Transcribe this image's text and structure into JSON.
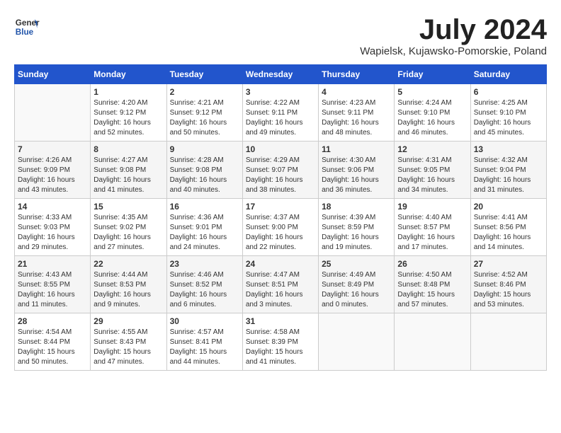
{
  "header": {
    "logo_line1": "General",
    "logo_line2": "Blue",
    "month_year": "July 2024",
    "location": "Wapielsk, Kujawsko-Pomorskie, Poland"
  },
  "days_of_week": [
    "Sunday",
    "Monday",
    "Tuesday",
    "Wednesday",
    "Thursday",
    "Friday",
    "Saturday"
  ],
  "weeks": [
    [
      {
        "num": "",
        "info": ""
      },
      {
        "num": "1",
        "info": "Sunrise: 4:20 AM\nSunset: 9:12 PM\nDaylight: 16 hours\nand 52 minutes."
      },
      {
        "num": "2",
        "info": "Sunrise: 4:21 AM\nSunset: 9:12 PM\nDaylight: 16 hours\nand 50 minutes."
      },
      {
        "num": "3",
        "info": "Sunrise: 4:22 AM\nSunset: 9:11 PM\nDaylight: 16 hours\nand 49 minutes."
      },
      {
        "num": "4",
        "info": "Sunrise: 4:23 AM\nSunset: 9:11 PM\nDaylight: 16 hours\nand 48 minutes."
      },
      {
        "num": "5",
        "info": "Sunrise: 4:24 AM\nSunset: 9:10 PM\nDaylight: 16 hours\nand 46 minutes."
      },
      {
        "num": "6",
        "info": "Sunrise: 4:25 AM\nSunset: 9:10 PM\nDaylight: 16 hours\nand 45 minutes."
      }
    ],
    [
      {
        "num": "7",
        "info": "Sunrise: 4:26 AM\nSunset: 9:09 PM\nDaylight: 16 hours\nand 43 minutes."
      },
      {
        "num": "8",
        "info": "Sunrise: 4:27 AM\nSunset: 9:08 PM\nDaylight: 16 hours\nand 41 minutes."
      },
      {
        "num": "9",
        "info": "Sunrise: 4:28 AM\nSunset: 9:08 PM\nDaylight: 16 hours\nand 40 minutes."
      },
      {
        "num": "10",
        "info": "Sunrise: 4:29 AM\nSunset: 9:07 PM\nDaylight: 16 hours\nand 38 minutes."
      },
      {
        "num": "11",
        "info": "Sunrise: 4:30 AM\nSunset: 9:06 PM\nDaylight: 16 hours\nand 36 minutes."
      },
      {
        "num": "12",
        "info": "Sunrise: 4:31 AM\nSunset: 9:05 PM\nDaylight: 16 hours\nand 34 minutes."
      },
      {
        "num": "13",
        "info": "Sunrise: 4:32 AM\nSunset: 9:04 PM\nDaylight: 16 hours\nand 31 minutes."
      }
    ],
    [
      {
        "num": "14",
        "info": "Sunrise: 4:33 AM\nSunset: 9:03 PM\nDaylight: 16 hours\nand 29 minutes."
      },
      {
        "num": "15",
        "info": "Sunrise: 4:35 AM\nSunset: 9:02 PM\nDaylight: 16 hours\nand 27 minutes."
      },
      {
        "num": "16",
        "info": "Sunrise: 4:36 AM\nSunset: 9:01 PM\nDaylight: 16 hours\nand 24 minutes."
      },
      {
        "num": "17",
        "info": "Sunrise: 4:37 AM\nSunset: 9:00 PM\nDaylight: 16 hours\nand 22 minutes."
      },
      {
        "num": "18",
        "info": "Sunrise: 4:39 AM\nSunset: 8:59 PM\nDaylight: 16 hours\nand 19 minutes."
      },
      {
        "num": "19",
        "info": "Sunrise: 4:40 AM\nSunset: 8:57 PM\nDaylight: 16 hours\nand 17 minutes."
      },
      {
        "num": "20",
        "info": "Sunrise: 4:41 AM\nSunset: 8:56 PM\nDaylight: 16 hours\nand 14 minutes."
      }
    ],
    [
      {
        "num": "21",
        "info": "Sunrise: 4:43 AM\nSunset: 8:55 PM\nDaylight: 16 hours\nand 11 minutes."
      },
      {
        "num": "22",
        "info": "Sunrise: 4:44 AM\nSunset: 8:53 PM\nDaylight: 16 hours\nand 9 minutes."
      },
      {
        "num": "23",
        "info": "Sunrise: 4:46 AM\nSunset: 8:52 PM\nDaylight: 16 hours\nand 6 minutes."
      },
      {
        "num": "24",
        "info": "Sunrise: 4:47 AM\nSunset: 8:51 PM\nDaylight: 16 hours\nand 3 minutes."
      },
      {
        "num": "25",
        "info": "Sunrise: 4:49 AM\nSunset: 8:49 PM\nDaylight: 16 hours\nand 0 minutes."
      },
      {
        "num": "26",
        "info": "Sunrise: 4:50 AM\nSunset: 8:48 PM\nDaylight: 15 hours\nand 57 minutes."
      },
      {
        "num": "27",
        "info": "Sunrise: 4:52 AM\nSunset: 8:46 PM\nDaylight: 15 hours\nand 53 minutes."
      }
    ],
    [
      {
        "num": "28",
        "info": "Sunrise: 4:54 AM\nSunset: 8:44 PM\nDaylight: 15 hours\nand 50 minutes."
      },
      {
        "num": "29",
        "info": "Sunrise: 4:55 AM\nSunset: 8:43 PM\nDaylight: 15 hours\nand 47 minutes."
      },
      {
        "num": "30",
        "info": "Sunrise: 4:57 AM\nSunset: 8:41 PM\nDaylight: 15 hours\nand 44 minutes."
      },
      {
        "num": "31",
        "info": "Sunrise: 4:58 AM\nSunset: 8:39 PM\nDaylight: 15 hours\nand 41 minutes."
      },
      {
        "num": "",
        "info": ""
      },
      {
        "num": "",
        "info": ""
      },
      {
        "num": "",
        "info": ""
      }
    ]
  ]
}
